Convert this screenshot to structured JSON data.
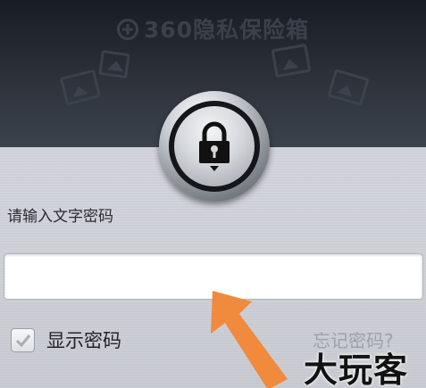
{
  "header": {
    "brand": "360隐私保险箱",
    "icons": [
      "plus-circle-icon",
      "photo-icon",
      "lock-icon"
    ]
  },
  "form": {
    "prompt": "请输入文字密码",
    "password_value": "",
    "show_password_label": "显示密码",
    "show_password_checked": true,
    "forgot_label": "忘记密码?"
  },
  "watermark": "大玩客",
  "colors": {
    "header_dark": "#1c2027",
    "panel_bg": "#d2d5db",
    "arrow": "#f08a3c",
    "link_gray": "#9ea2a8"
  }
}
